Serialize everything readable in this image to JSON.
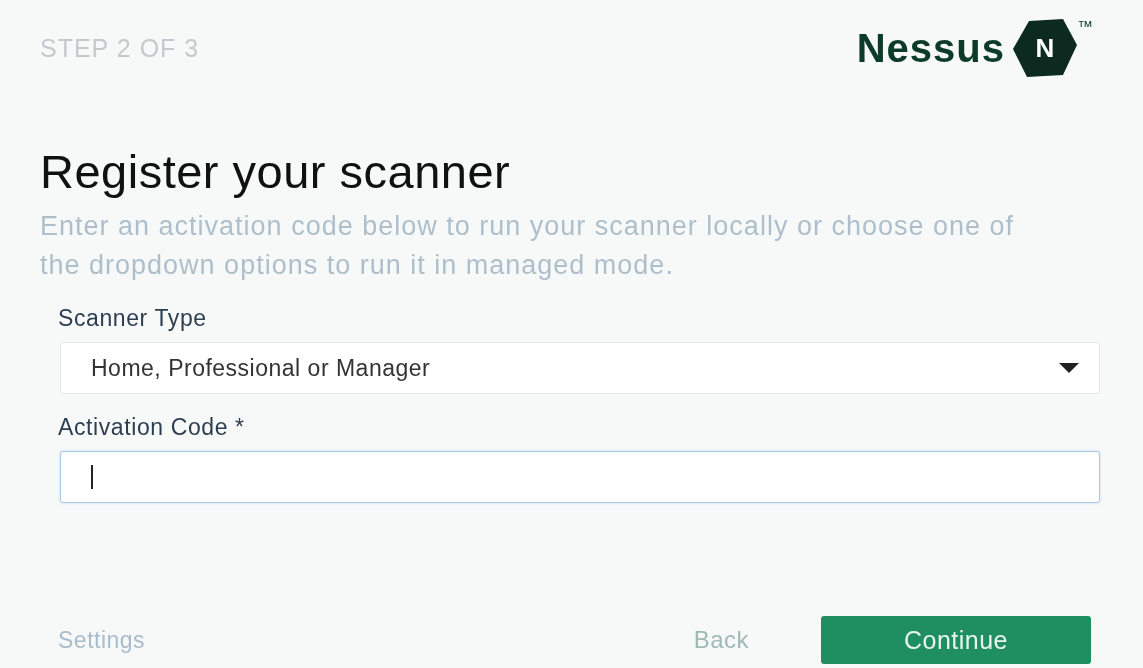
{
  "header": {
    "step": "STEP 2 OF 3",
    "logo": {
      "name": "Nessus",
      "mark": "N",
      "trademark": "™"
    }
  },
  "title": "Register your scanner",
  "description": "Enter an activation code below to run your scanner locally or choose one of the dropdown options to run it in managed mode.",
  "fields": [
    {
      "kind": "select",
      "label": "Scanner Type",
      "value": "Home, Professional or Manager"
    },
    {
      "kind": "text",
      "label": "Activation Code *",
      "focused": true
    }
  ],
  "footer": {
    "settings": "Settings",
    "back": "Back",
    "continue": "Continue"
  }
}
